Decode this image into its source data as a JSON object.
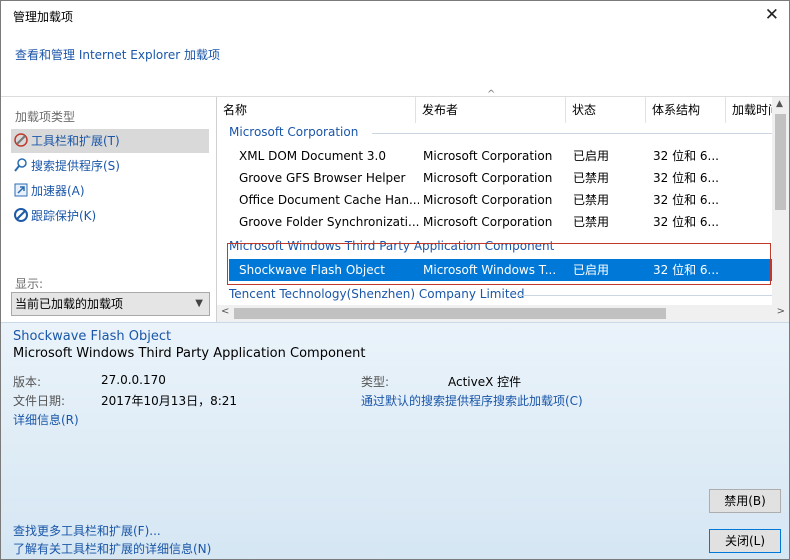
{
  "window": {
    "title": "管理加载项",
    "subtitle": "查看和管理 Internet Explorer 加载项"
  },
  "sidebar": {
    "label": "加载项类型",
    "items": [
      {
        "label": "工具栏和扩展(T)",
        "icon": "toolbar-icon",
        "selected": true
      },
      {
        "label": "搜索提供程序(S)",
        "icon": "search-icon"
      },
      {
        "label": "加速器(A)",
        "icon": "accelerator-icon"
      },
      {
        "label": "跟踪保护(K)",
        "icon": "tracking-protection-icon"
      }
    ],
    "show_label": "显示:",
    "show_value": "当前已加载的加载项"
  },
  "table": {
    "columns": [
      "名称",
      "发布者",
      "状态",
      "体系结构",
      "加载时间"
    ],
    "groups": [
      {
        "name": "Microsoft Corporation",
        "rows": [
          [
            "XML DOM Document 3.0",
            "Microsoft Corporation",
            "已启用",
            "32 位和 6..."
          ],
          [
            "Groove GFS Browser Helper",
            "Microsoft Corporation",
            "已禁用",
            "32 位和 6..."
          ],
          [
            "Office Document Cache Han...",
            "Microsoft Corporation",
            "已禁用",
            "32 位和 6..."
          ],
          [
            "Groove Folder Synchronizati...",
            "Microsoft Corporation",
            "已禁用",
            "32 位和 6..."
          ]
        ]
      },
      {
        "name": "Microsoft Windows Third Party Application Component",
        "rows": [
          [
            "Shockwave Flash Object",
            "Microsoft Windows T...",
            "已启用",
            "32 位和 6..."
          ]
        ]
      },
      {
        "name": "Tencent Technology(Shenzhen) Company Limited",
        "rows": []
      }
    ]
  },
  "details": {
    "name": "Shockwave Flash Object",
    "publisher": "Microsoft Windows Third Party Application Component",
    "version_label": "版本:",
    "version": "27.0.0.170",
    "date_label": "文件日期:",
    "date": "2017年10月13日，8:21",
    "more_info": "详细信息(R)",
    "type_label": "类型:",
    "type": "ActiveX 控件",
    "search_link": "通过默认的搜索提供程序搜索此加载项(C)"
  },
  "buttons": {
    "disable": "禁用(B)",
    "close": "关闭(L)"
  },
  "footer": {
    "link1": "查找更多工具栏和扩展(F)...",
    "link2": "了解有关工具栏和扩展的详细信息(N)"
  }
}
